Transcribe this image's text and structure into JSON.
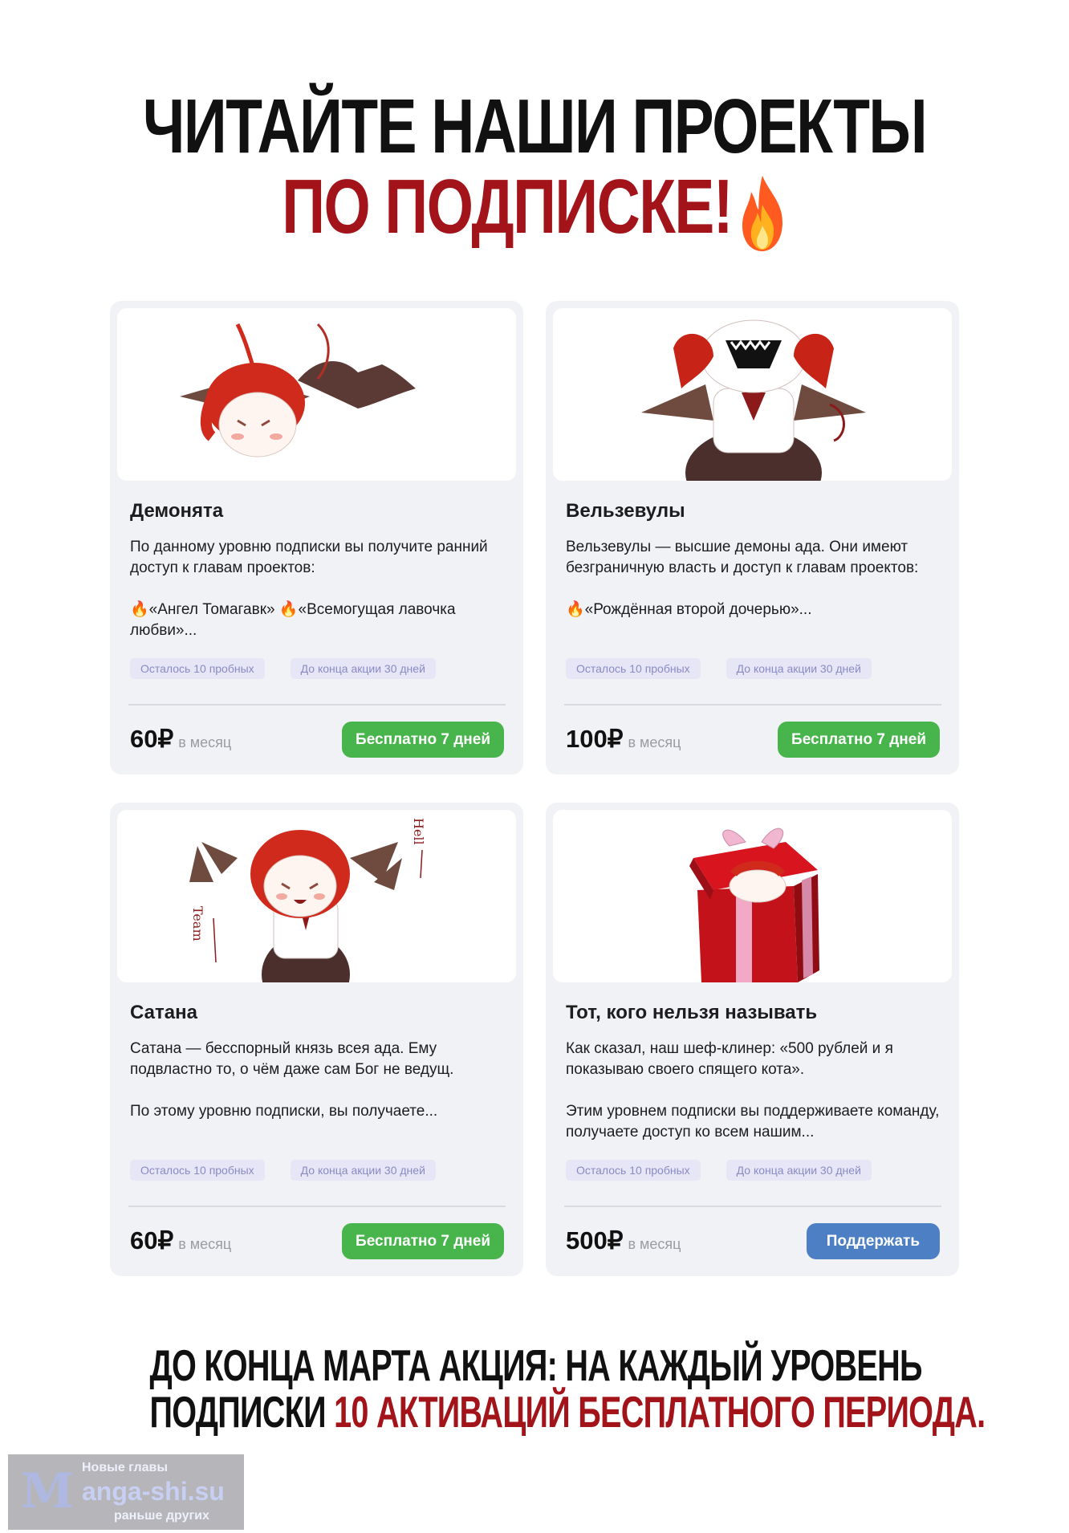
{
  "header": {
    "line1": "ЧИТАЙТЕ НАШИ ПРОЕКТЫ",
    "line2": "ПО ПОДПИСКЕ!",
    "emoji": "fire-icon"
  },
  "tiers": [
    {
      "name": "Демонята",
      "paragraphs": [
        "По данному уровню подписки вы получите ранний доступ к главам проектов:",
        "🔥«Ангел Томагавк» 🔥«Всемогущая лавочка любви»..."
      ],
      "tag_trials": "Осталось 10 пробных",
      "tag_promo": "До конца акции 30 дней",
      "price": "60₽",
      "period": "в месяц",
      "button": "Бесплатно 7 дней"
    },
    {
      "name": "Вельзевулы",
      "paragraphs": [
        "Вельзевулы — высшие демоны ада. Они имеют безграничную власть и доступ к главам проектов:",
        "🔥«Рождённая второй дочерью»..."
      ],
      "tag_trials": "Осталось 10 пробных",
      "tag_promo": "До конца акции 30 дней",
      "price": "100₽",
      "period": "в месяц",
      "button": "Бесплатно 7 дней"
    },
    {
      "name": "Сатана",
      "paragraphs": [
        "Сатана — бесспорный князь всея ада. Ему подвластно то, о чём даже сам Бог не ведущ.",
        "По этому уровню подписки, вы получаете..."
      ],
      "tag_trials": "Осталось 10 пробных",
      "tag_promo": "До конца акции 30 дней",
      "price": "60₽",
      "period": "в месяц",
      "button": "Бесплатно 7 дней"
    },
    {
      "name": "Тот, кого нельзя называть",
      "paragraphs": [
        "Как сказал, наш шеф-клинер: «500 рублей и я показываю своего спящего кота».",
        "Этим уровнем подписки вы поддерживаете команду, получаете доступ ко всем нашим..."
      ],
      "tag_trials": "Осталось 10 пробных",
      "tag_promo": "До конца акции 30 дней",
      "price": "500₽",
      "period": "в месяц",
      "button": "Поддержать"
    }
  ],
  "illustration_text": {
    "team": "Team",
    "hell": "Hell"
  },
  "footer": {
    "line1": "ДО КОНЦА МАРТА АКЦИЯ: НА КАЖДЫЙ УРОВЕНЬ",
    "line2_black": "ПОДПИСКИ",
    "line2_red": "10 АКТИВАЦИЙ БЕСПЛАТНОГО ПЕРИОДА."
  },
  "watermark": {
    "top": "Новые главы",
    "brand": "anga-shi.su",
    "letter": "M",
    "bottom": "раньше других"
  },
  "colors": {
    "accent_red": "#a3141a",
    "green_button": "#47b54b",
    "blue_button": "#4d7fc4",
    "tag_bg": "#e6e6f6",
    "card_bg": "#f1f2f5"
  }
}
